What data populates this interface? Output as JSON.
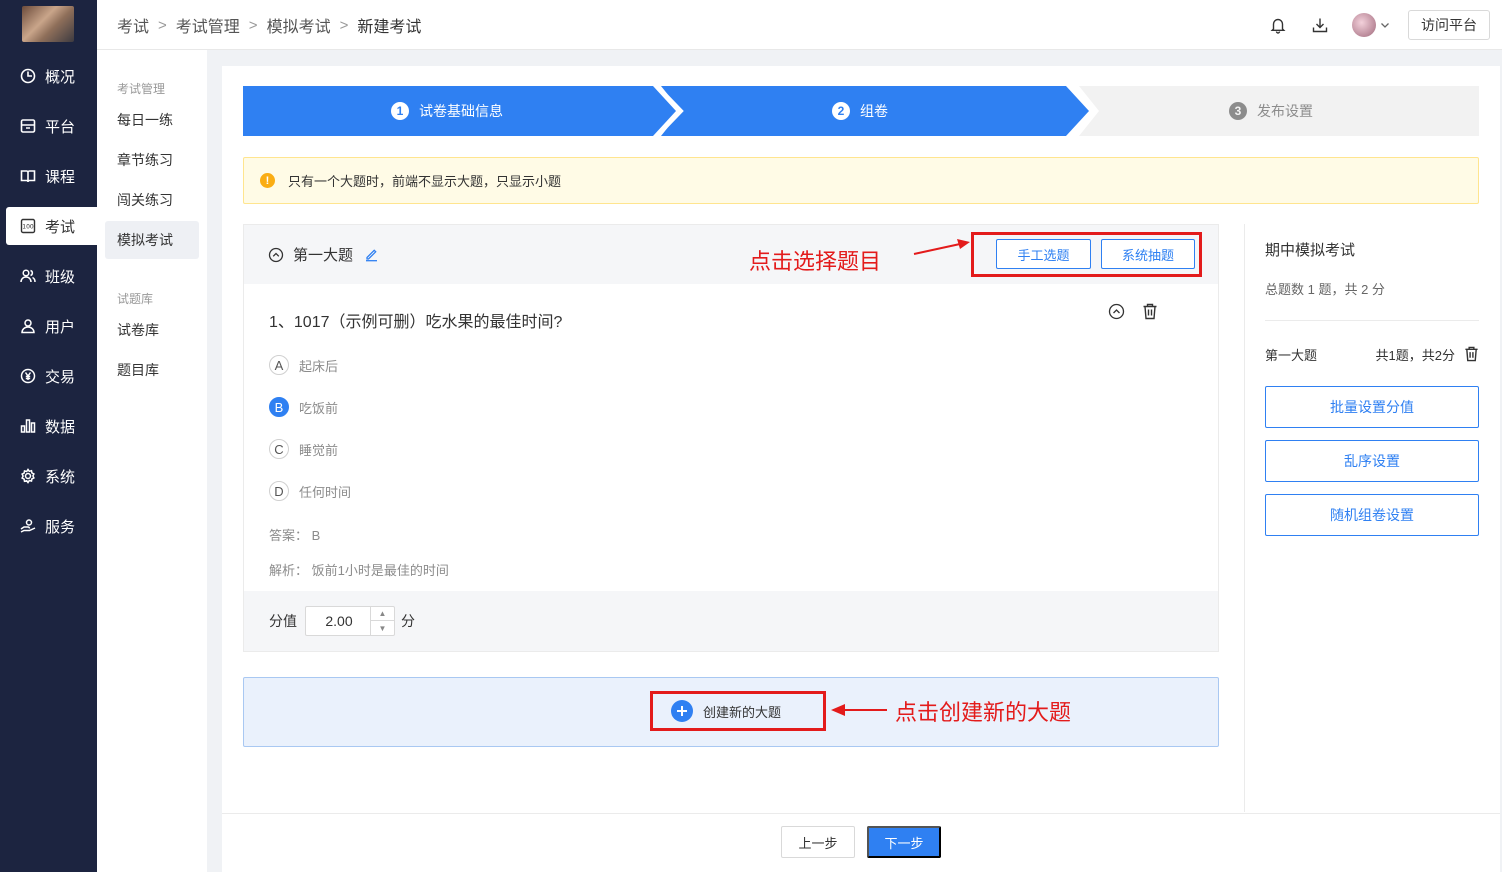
{
  "nav": {
    "items": [
      {
        "label": "概况",
        "icon": "dashboard-icon"
      },
      {
        "label": "平台",
        "icon": "platform-icon"
      },
      {
        "label": "课程",
        "icon": "book-icon"
      },
      {
        "label": "考试",
        "icon": "exam-icon"
      },
      {
        "label": "班级",
        "icon": "class-icon"
      },
      {
        "label": "用户",
        "icon": "user-icon"
      },
      {
        "label": "交易",
        "icon": "yen-icon"
      },
      {
        "label": "数据",
        "icon": "chart-icon"
      },
      {
        "label": "系统",
        "icon": "gear-icon"
      },
      {
        "label": "服务",
        "icon": "service-icon"
      }
    ],
    "active": "考试"
  },
  "submenu": {
    "group1": "考试管理",
    "items1": [
      "每日一练",
      "章节练习",
      "闯关练习",
      "模拟考试"
    ],
    "group2": "试题库",
    "items2": [
      "试卷库",
      "题目库"
    ],
    "active": "模拟考试"
  },
  "header": {
    "breadcrumbs": [
      "考试",
      "考试管理",
      "模拟考试",
      "新建考试"
    ],
    "visit_button": "访问平台"
  },
  "steps": [
    {
      "num": "1",
      "label": "试卷基础信息",
      "state": "done"
    },
    {
      "num": "2",
      "label": "组卷",
      "state": "active"
    },
    {
      "num": "3",
      "label": "发布设置",
      "state": "todo"
    }
  ],
  "notice": "只有一个大题时，前端不显示大题，只显示小题",
  "section": {
    "title": "第一大题",
    "manual_button": "手工选题",
    "system_button": "系统抽题",
    "callout": "点击选择题目",
    "question": {
      "title": "1、1017（示例可删）吃水果的最佳时间?",
      "options": [
        {
          "letter": "A",
          "text": "起床后",
          "selected": false
        },
        {
          "letter": "B",
          "text": "吃饭前",
          "selected": true
        },
        {
          "letter": "C",
          "text": "睡觉前",
          "selected": false
        },
        {
          "letter": "D",
          "text": "任何时间",
          "selected": false
        }
      ],
      "answer": "答案： B",
      "analysis": "解析： 饭前1小时是最佳的时间"
    },
    "score_label": "分值",
    "score_value": "2.00",
    "score_unit": "分"
  },
  "create": {
    "label": "创建新的大题",
    "callout": "点击创建新的大题"
  },
  "right_panel": {
    "title": "期中模拟考试",
    "summary": "总题数 1 题，共 2 分",
    "row_name": "第一大题",
    "row_count": "共1题，共2分",
    "buttons": [
      "批量设置分值",
      "乱序设置",
      "随机组卷设置"
    ]
  },
  "footer": {
    "prev": "上一步",
    "next": "下一步"
  },
  "colors": {
    "primary": "#2f80f2",
    "nav_bg": "#1c2440",
    "annotation_red": "#e31b1b",
    "notice_bg": "#fffbe6"
  }
}
